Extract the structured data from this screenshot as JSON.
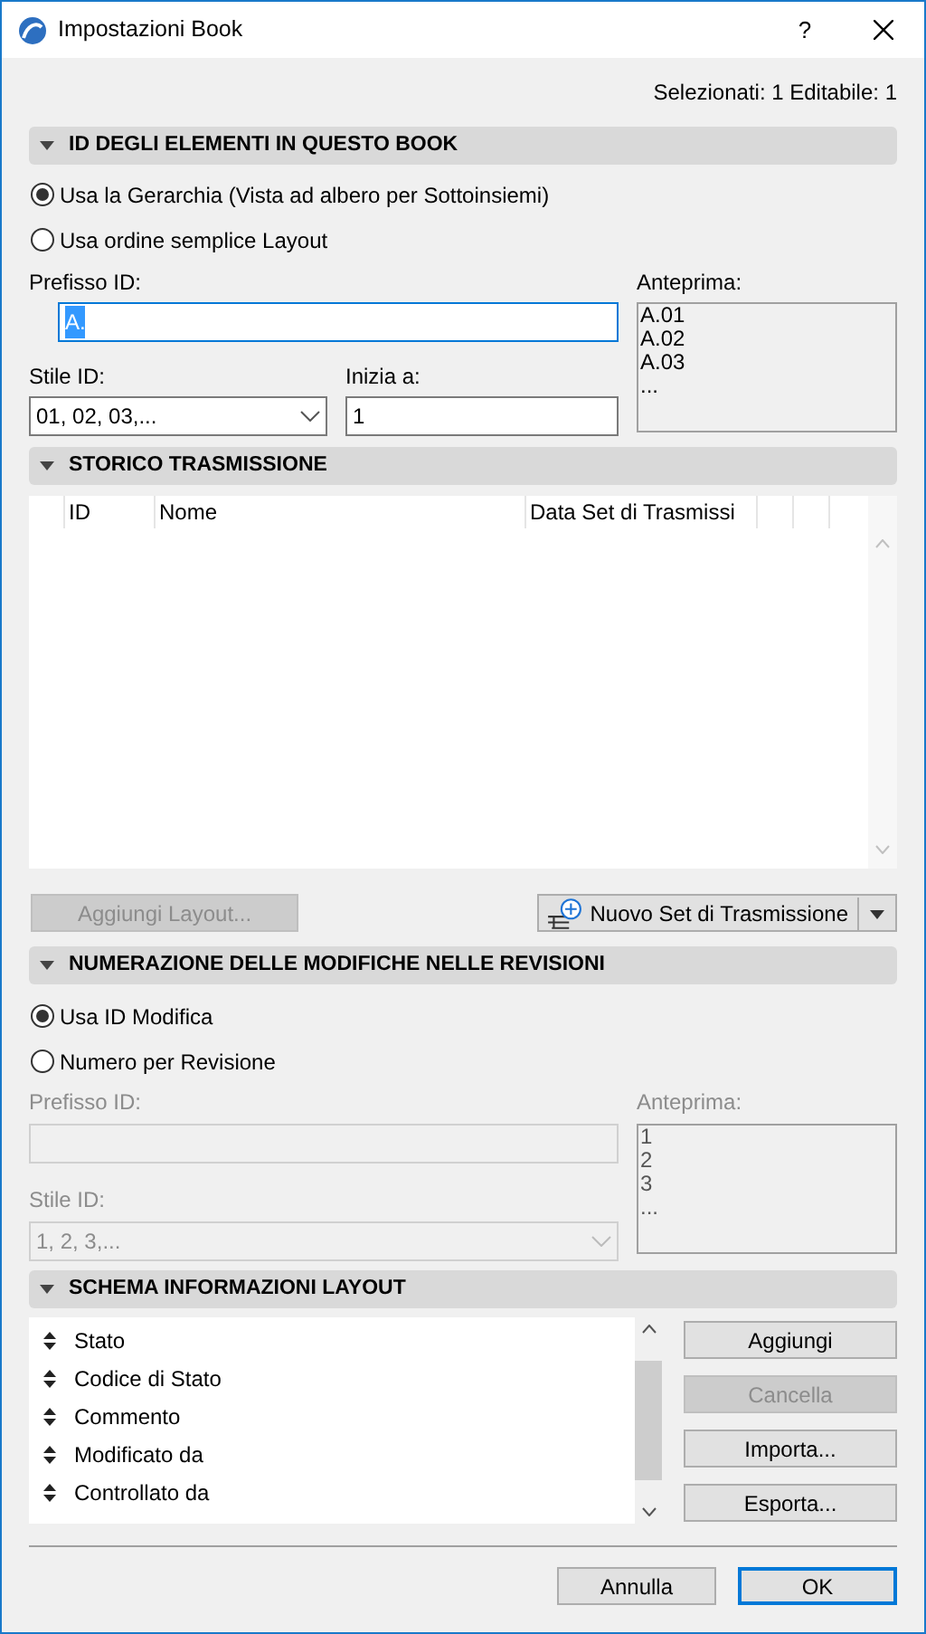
{
  "window": {
    "title": "Impostazioni Book",
    "help": "?"
  },
  "selection_info": "Selezionati: 1 Editabile: 1",
  "id_section": {
    "title": "ID DEGLI ELEMENTI IN QUESTO BOOK",
    "expanded": true,
    "options": [
      {
        "label": "Usa la Gerarchia (Vista ad albero per Sottoinsiemi)",
        "selected": true
      },
      {
        "label": "Usa ordine semplice Layout",
        "selected": false
      }
    ],
    "prefix_label": "Prefisso ID:",
    "prefix_value": "A.",
    "style_label": "Stile ID:",
    "style_value": "01, 02, 03,...",
    "start_label": "Inizia a:",
    "start_value": "1",
    "preview_label": "Anteprima:",
    "preview": [
      "A.01",
      "A.02",
      "A.03",
      "..."
    ]
  },
  "transmission_section": {
    "title": "STORICO TRASMISSIONE",
    "expanded": true,
    "columns": [
      "ID",
      "Nome",
      "Data Set di Trasmissi"
    ],
    "add_button": {
      "label": "Aggiungi Layout...",
      "disabled": true
    },
    "new_button": {
      "label": "Nuovo Set di Trasmissione"
    }
  },
  "revision_section": {
    "title": "NUMERAZIONE DELLE MODIFICHE NELLE REVISIONI",
    "expanded": true,
    "options": [
      {
        "label": "Usa ID Modifica",
        "selected": true
      },
      {
        "label": "Numero per Revisione",
        "selected": false
      }
    ],
    "disabled": true,
    "prefix_label": "Prefisso ID:",
    "style_label": "Stile ID:",
    "style_value": "1, 2, 3,...",
    "preview_label": "Anteprima:",
    "preview": [
      "1",
      "2",
      "3",
      "..."
    ]
  },
  "layout_section": {
    "title": "SCHEMA INFORMAZIONI LAYOUT",
    "expanded": true,
    "items": [
      "Stato",
      "Codice di Stato",
      "Commento",
      "Modificato da",
      "Controllato da"
    ],
    "buttons": [
      {
        "label": "Aggiungi",
        "disabled": false
      },
      {
        "label": "Cancella",
        "disabled": true
      },
      {
        "label": "Importa...",
        "disabled": false
      },
      {
        "label": "Esporta...",
        "disabled": false
      }
    ]
  },
  "footer": [
    {
      "label": "Annulla",
      "default": false
    },
    {
      "label": "OK",
      "default": true
    }
  ]
}
